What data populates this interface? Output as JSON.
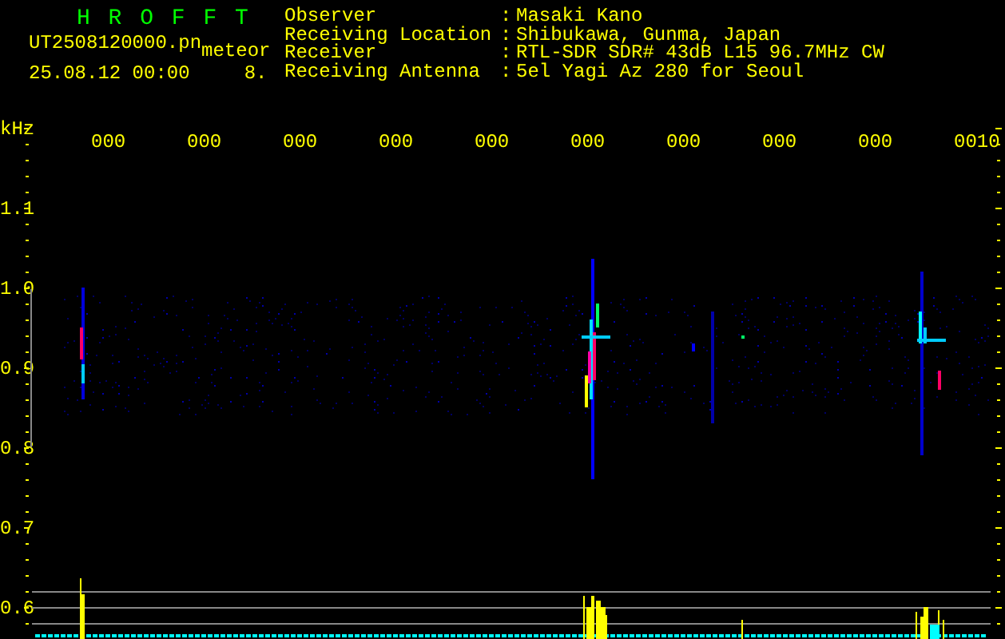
{
  "header": {
    "title": "H R O F F T",
    "file": "UT2508120000.pn",
    "mode": "meteor",
    "datetime": "25.08.12 00:00",
    "count": "8."
  },
  "info": [
    {
      "label": "Observer",
      "colon": ":",
      "value": "Masaki Kano"
    },
    {
      "label": "Receiving Location",
      "colon": ":",
      "value": "Shibukawa, Gunma, Japan"
    },
    {
      "label": "Receiver",
      "colon": ":",
      "value": "RTL-SDR SDR# 43dB L15 96.7MHz CW"
    },
    {
      "label": "Receiving Antenna",
      "colon": ":",
      "value": "5el Yagi Az 280 for Seoul"
    }
  ],
  "plot": {
    "unit": "kHz",
    "time_labels": [
      "000",
      "000",
      "000",
      "000",
      "000",
      "000",
      "000",
      "000",
      "000",
      "0010"
    ],
    "freq_labels": [
      "1.1",
      "1.0",
      "0.9",
      "0.8",
      "0.7",
      "0.6"
    ]
  }
}
